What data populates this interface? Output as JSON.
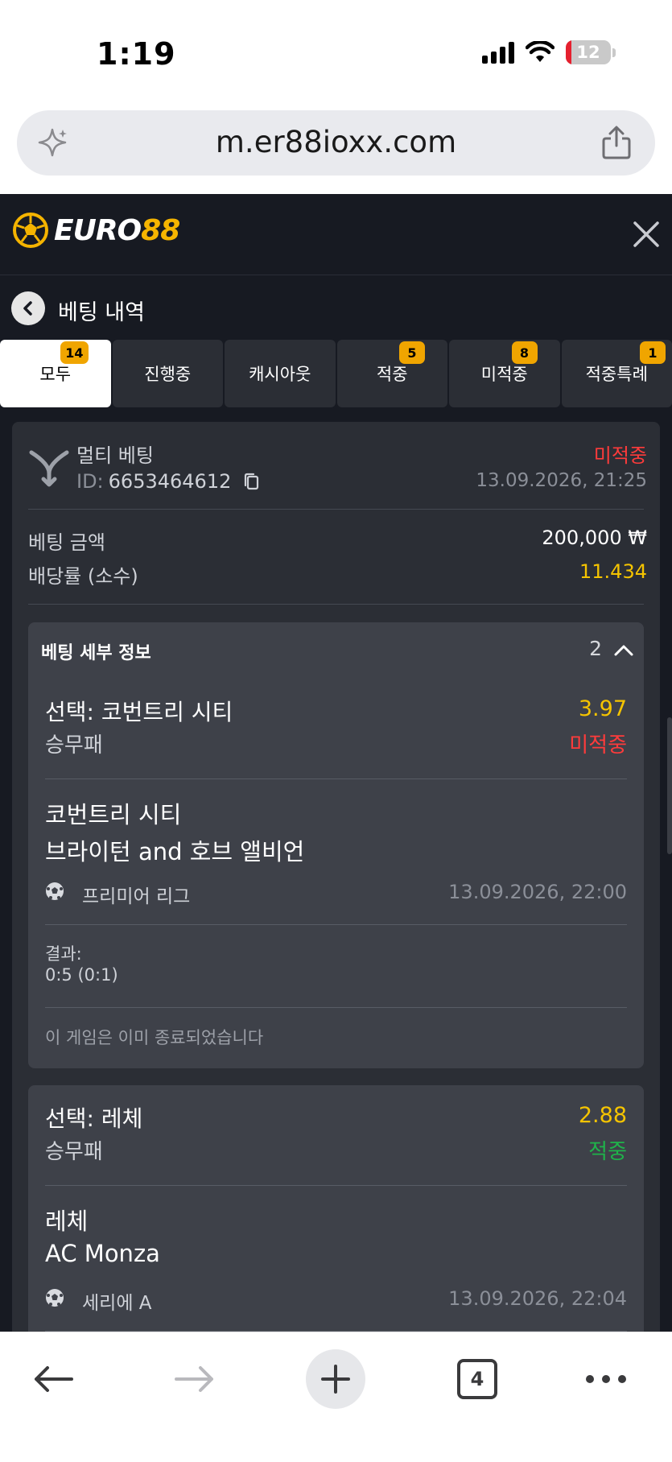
{
  "status_bar": {
    "time": "1:19",
    "battery": "12"
  },
  "browser": {
    "url": "m.er88ioxx.com",
    "tab_count": "4"
  },
  "app": {
    "logo_white": "EURO",
    "logo_yellow": "88",
    "page_title": "베팅 내역"
  },
  "tabs": [
    {
      "label": "모두",
      "badge": "14",
      "active": true
    },
    {
      "label": "진행중",
      "badge": ""
    },
    {
      "label": "캐시아웃",
      "badge": ""
    },
    {
      "label": "적중",
      "badge": "5"
    },
    {
      "label": "미적중",
      "badge": "8"
    },
    {
      "label": "적중특례",
      "badge": "1"
    }
  ],
  "bet": {
    "type": "멀티 베팅",
    "id_label": "ID:",
    "id": "6653464612",
    "status": "미적중",
    "datetime": "13.09.2026, 21:25",
    "amount_label": "베팅 금액",
    "amount": "200,000 ₩",
    "odds_label": "배당률 (소수)",
    "odds": "11.434",
    "details_title": "베팅 세부 정보",
    "details_count": "2"
  },
  "selections": [
    {
      "pick": "선택: 코번트리 시티",
      "market": "승무패",
      "odds": "3.97",
      "result": "미적중",
      "team1": "코번트리 시티",
      "team2": "브라이턴 and 호브 앨비언",
      "league": "프리미어 리그",
      "match_datetime": "13.09.2026, 22:00",
      "result_label": "결과:",
      "score": "0:5 (0:1)",
      "note": "이 게임은 이미 종료되었습니다"
    },
    {
      "pick": "선택: 레체",
      "market": "승무패",
      "odds": "2.88",
      "result": "적중",
      "team1": "레체",
      "team2": "AC Monza",
      "league": "세리에 A",
      "match_datetime": "13.09.2026, 22:04"
    }
  ],
  "colors": {
    "app_bg": "#171a22",
    "card_bg": "#2b2e35",
    "lost": "#ff3b3b",
    "won": "#1fb34a",
    "odds": "#f5c400",
    "accent": "#f5b400"
  }
}
